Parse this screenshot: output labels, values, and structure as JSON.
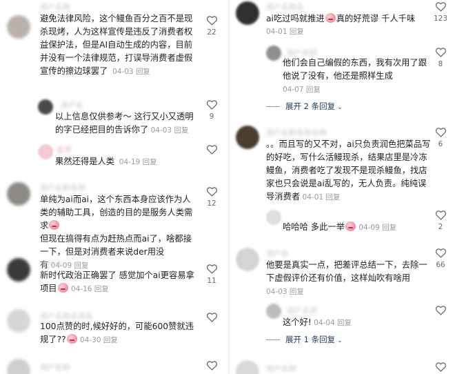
{
  "left": {
    "comments": [
      {
        "text": "避免法律风险，这个鳗鱼百分之百不是现杀现烤，人为这样宣传是违反了消费者权益保护法，但是AI自动生成的内容，目前并没有一个法律规范，打误导消费者虚假宣传的擦边球罢了",
        "date": "04-03",
        "reply": "回复",
        "likes": "22"
      },
      {
        "text": "以上信息仅供参考～ 这行又小又透明的字已经把目的告诉你了",
        "date": "04-03",
        "reply": "回复",
        "likes": "9"
      },
      {
        "text": "果然还得是人类",
        "date": "04-19",
        "reply": "回复",
        "likes": ""
      },
      {
        "text_a": "单纯为ai而ai，这个东西本身应该作为人类的辅助工具，创造的目的是服务人类需求",
        "text_b": "但现在搞得有点为赶热点而ai了，啥都接一下，但是对消费者来说der用没有",
        "date": "04-09",
        "reply": "回复",
        "likes": "12"
      },
      {
        "text_a": "新时代政治正确罢了 感觉加个ai更容易拿项目",
        "date": "04-16",
        "reply": "回复",
        "likes": "11"
      },
      {
        "text_a": "100点赞的时,候好好的，可能600赞就违规了??",
        "date": "04-30",
        "reply": "回复",
        "likes": ""
      }
    ]
  },
  "right": {
    "comments": [
      {
        "text_a": "ai吃过吗就推进",
        "text_b": "真的好荒谬 千人千味",
        "date": "04-01",
        "reply": "回复",
        "likes": "123"
      },
      {
        "text": "他们会自己编假的东西，我有次用了跟他说了没有，他还是照样生成",
        "date": "04-07",
        "reply": "回复",
        "likes": "8"
      },
      {
        "text": "。。而且写的又不对，ai只负责润色把菜品写的好吃，写什么活鳗现杀，结果店里是冷冻鳗鱼，消费者吃了发现不是现杀鳗鱼，找店家也只会说是ai乱写的，无人负责。纯纯误导消费者",
        "date": "04-01",
        "reply": "回复",
        "likes": "6"
      },
      {
        "text": "哈哈哈 多此一举",
        "date": "04-09",
        "reply": "回复",
        "likes": "2"
      },
      {
        "text": "他要是真实一点，把差评总结一下，去除一下虚假评价还有价值，这样灿吹有啥用",
        "date": "04-03",
        "reply": "回复",
        "likes": "66"
      },
      {
        "text": "这个好!",
        "date": "04-04",
        "reply": "回复",
        "likes": ""
      }
    ],
    "expand_1": "展开 2 条回复",
    "expand_2": "展开 1 条回复"
  }
}
